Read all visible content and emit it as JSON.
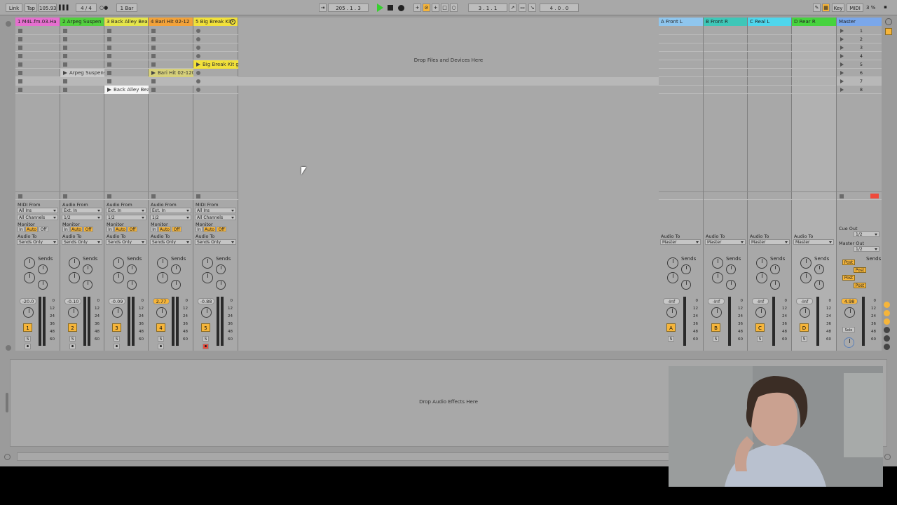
{
  "toolbar": {
    "link": "Link",
    "tap": "Tap",
    "tempo": "105.93",
    "time_sig_num": "4",
    "time_sig_den": "4",
    "quantize": "1 Bar",
    "arr_pos": "205 .   1 .   3",
    "punch_start": "3 .   1 .   1",
    "loop_len": "4 .   0 .   0",
    "key": "Key",
    "midi": "MIDI",
    "cpu": "3 %"
  },
  "session": {
    "drop_files": "Drop Files and Devices Here",
    "tracks": [
      {
        "title": "1 M4L.fm.03.Ha",
        "color": "#e56fcf",
        "input_label": "MIDI From",
        "input": "All Ins",
        "channel": "All Channels",
        "mon_in": "In",
        "mon_auto": "Auto",
        "mon_off": "Off",
        "output_label": "Audio To",
        "output": "Sends Only",
        "volume": "-20.0",
        "number": "1",
        "solo": "S"
      },
      {
        "title": "2 Arpeg Suspen",
        "color": "#52d03e",
        "input_label": "Audio From",
        "input": "Ext. In",
        "channel": "1/2",
        "mon_in": "In",
        "mon_auto": "Auto",
        "mon_off": "Off",
        "output_label": "Audio To",
        "output": "Sends Only",
        "volume": "-0.10",
        "number": "2",
        "solo": "S",
        "clip": "Arpeg Suspens"
      },
      {
        "title": "3 Back Alley Bea",
        "color": "#e4e54a",
        "input_label": "Audio From",
        "input": "Ext. In",
        "channel": "1/2",
        "mon_in": "In",
        "mon_auto": "Auto",
        "mon_off": "Off",
        "output_label": "Audio To",
        "output": "Sends Only",
        "volume": "-0.09",
        "number": "3",
        "solo": "S",
        "clip": "Back Alley Beat"
      },
      {
        "title": "4 Bari Hit 02-12",
        "color": "#f2a23a",
        "input_label": "Audio From",
        "input": "Ext. In",
        "channel": "1/2",
        "mon_in": "In",
        "mon_auto": "Auto",
        "mon_off": "Off",
        "output_label": "Audio To",
        "output": "Sends Only",
        "volume": "2.77",
        "number": "4",
        "solo": "S",
        "clip": "Bari Hit 02-120"
      },
      {
        "title": "5 Big Break Kit",
        "color": "#f2e13a",
        "input_label": "MIDI From",
        "input": "All Ins",
        "channel": "All Channels",
        "mon_in": "In",
        "mon_auto": "Auto",
        "mon_off": "Off",
        "output_label": "Audio To",
        "output": "Sends Only",
        "volume": "-0.88",
        "number": "5",
        "solo": "S",
        "clip": "Big Break Kit gr"
      }
    ],
    "returns": [
      {
        "title": "A Front L",
        "color": "#8fc6ee",
        "output_label": "Audio To",
        "output": "Master",
        "volume": "-Inf",
        "letter": "A",
        "solo": "S"
      },
      {
        "title": "B Front R",
        "color": "#3ec7b8",
        "output_label": "Audio To",
        "output": "Master",
        "volume": "-Inf",
        "letter": "B",
        "solo": "S"
      },
      {
        "title": "C Real L",
        "color": "#4fd6ec",
        "output_label": "Audio To",
        "output": "Master",
        "volume": "-Inf",
        "letter": "C",
        "solo": "S"
      },
      {
        "title": "D Rear R",
        "color": "#46d33e",
        "output_label": "Audio To",
        "output": "Master",
        "volume": "-Inf",
        "letter": "D",
        "solo": "S"
      }
    ],
    "master": {
      "title": "Master",
      "color": "#7aa7ea",
      "cue_label": "Cue Out",
      "cue": "1/2",
      "out_label": "Master Out",
      "out": "1/2",
      "volume": "4.98",
      "solo": "Solo",
      "scenes": [
        "1",
        "2",
        "3",
        "4",
        "5",
        "6",
        "7",
        "8"
      ],
      "post": [
        "Post",
        "Post",
        "Post",
        "Post"
      ]
    },
    "sends_label": "Sends",
    "send_letters": [
      "A",
      "B",
      "C",
      "D"
    ],
    "scale": [
      "0",
      "12",
      "24",
      "36",
      "48",
      "60"
    ]
  },
  "device_area": {
    "drop_effects": "Drop Audio Effects Here"
  }
}
